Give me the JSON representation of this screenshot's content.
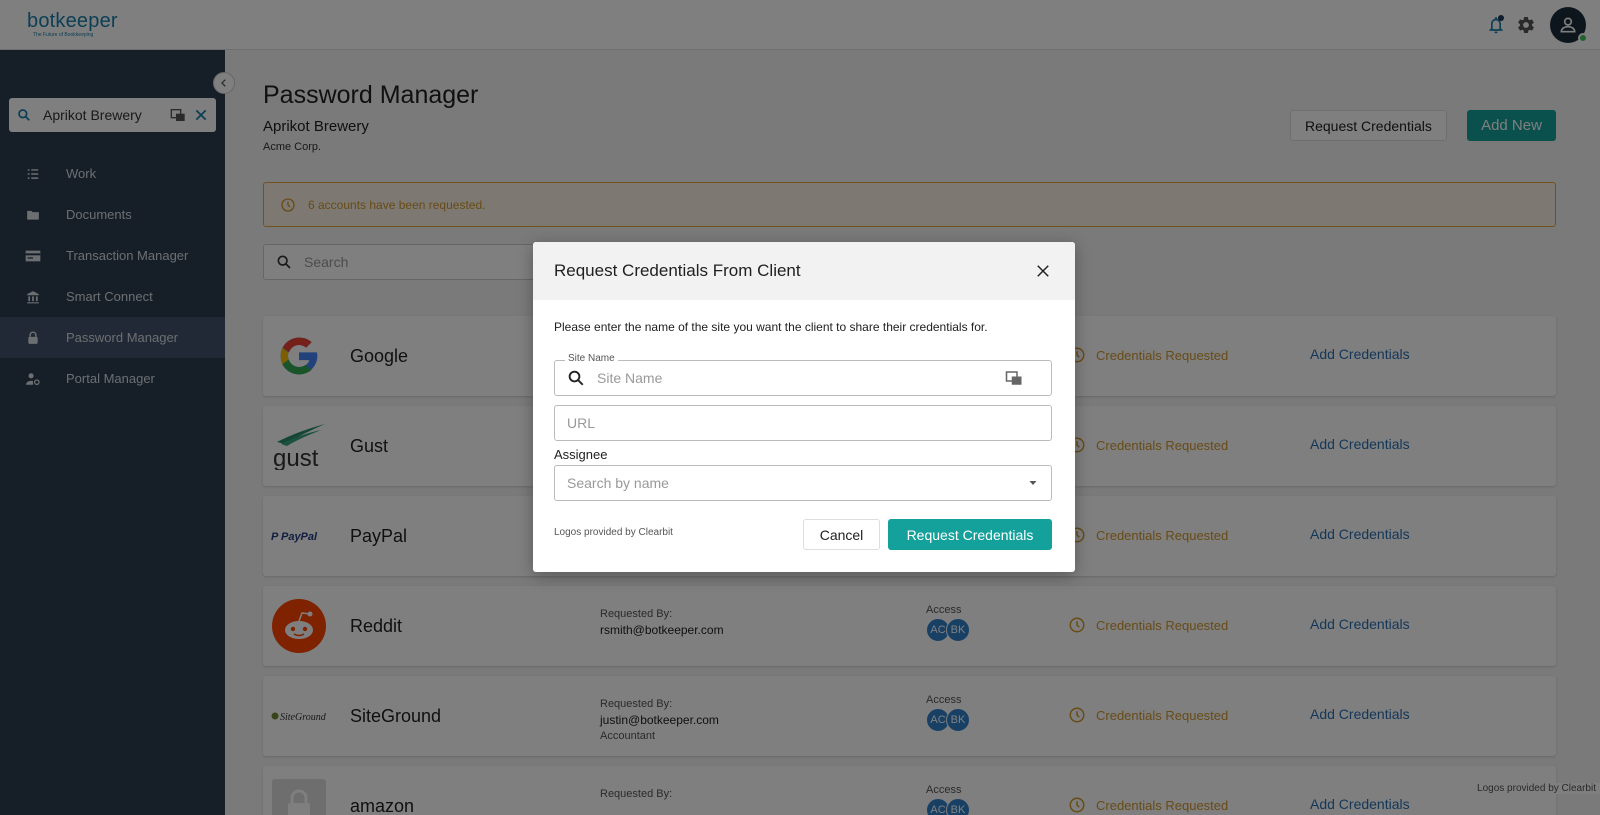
{
  "header": {
    "logo_text": "botkeeper",
    "logo_tagline": "The Future of Bookkeeping"
  },
  "sidebar": {
    "client_search_value": "Aprikot Brewery",
    "items": [
      {
        "label": "Work",
        "icon": "list-icon"
      },
      {
        "label": "Documents",
        "icon": "folder-icon"
      },
      {
        "label": "Transaction Manager",
        "icon": "card-icon"
      },
      {
        "label": "Smart Connect",
        "icon": "bank-icon"
      },
      {
        "label": "Password Manager",
        "icon": "lock-icon",
        "active": true
      },
      {
        "label": "Portal Manager",
        "icon": "user-gear-icon"
      }
    ]
  },
  "main": {
    "title": "Password Manager",
    "client_name": "Aprikot Brewery",
    "org_name": "Acme Corp.",
    "request_button": "Request Credentials",
    "add_new_button": "Add New",
    "alert_text": "6 accounts have been requested.",
    "search_placeholder": "Search",
    "footer_note": "Logos provided by Clearbit",
    "rows": [
      {
        "name": "Google",
        "requested_by_label": "",
        "requested_by": "",
        "role": "",
        "access_label": "",
        "status": "Credentials Requested",
        "action": "Add Credentials"
      },
      {
        "name": "Gust",
        "requested_by_label": "",
        "requested_by": "",
        "role": "",
        "access_label": "",
        "status": "Credentials Requested",
        "action": "Add Credentials"
      },
      {
        "name": "PayPal",
        "requested_by_label": "",
        "requested_by": "",
        "role": "",
        "access_label": "",
        "status": "Credentials Requested",
        "action": "Add Credentials"
      },
      {
        "name": "Reddit",
        "requested_by_label": "Requested By:",
        "requested_by": "rsmith@botkeeper.com",
        "role": "",
        "access_label": "Access",
        "badges": [
          "AC",
          "BK"
        ],
        "status": "Credentials Requested",
        "action": "Add Credentials"
      },
      {
        "name": "SiteGround",
        "requested_by_label": "Requested By:",
        "requested_by": "justin@botkeeper.com",
        "role": "Accountant",
        "access_label": "Access",
        "badges": [
          "AC",
          "BK"
        ],
        "status": "Credentials Requested",
        "action": "Add Credentials"
      },
      {
        "name": "amazon",
        "requested_by_label": "Requested By:",
        "requested_by": "",
        "role": "",
        "access_label": "Access",
        "badges": [
          "AC",
          "BK"
        ],
        "status": "Credentials Requested",
        "action": "Add Credentials"
      }
    ]
  },
  "modal": {
    "title": "Request Credentials From Client",
    "description": "Please enter the name of the site you want the client to share their credentials for.",
    "site_name_legend": "Site Name",
    "site_name_placeholder": "Site Name",
    "url_placeholder": "URL",
    "assignee_label": "Assignee",
    "assignee_placeholder": "Search by name",
    "footer_note": "Logos provided by Clearbit",
    "cancel_label": "Cancel",
    "submit_label": "Request Credentials"
  },
  "colors": {
    "accent": "#14a19b",
    "sidebar": "#2c3e50",
    "warning": "#d0962d",
    "link": "#2a6fb0"
  }
}
